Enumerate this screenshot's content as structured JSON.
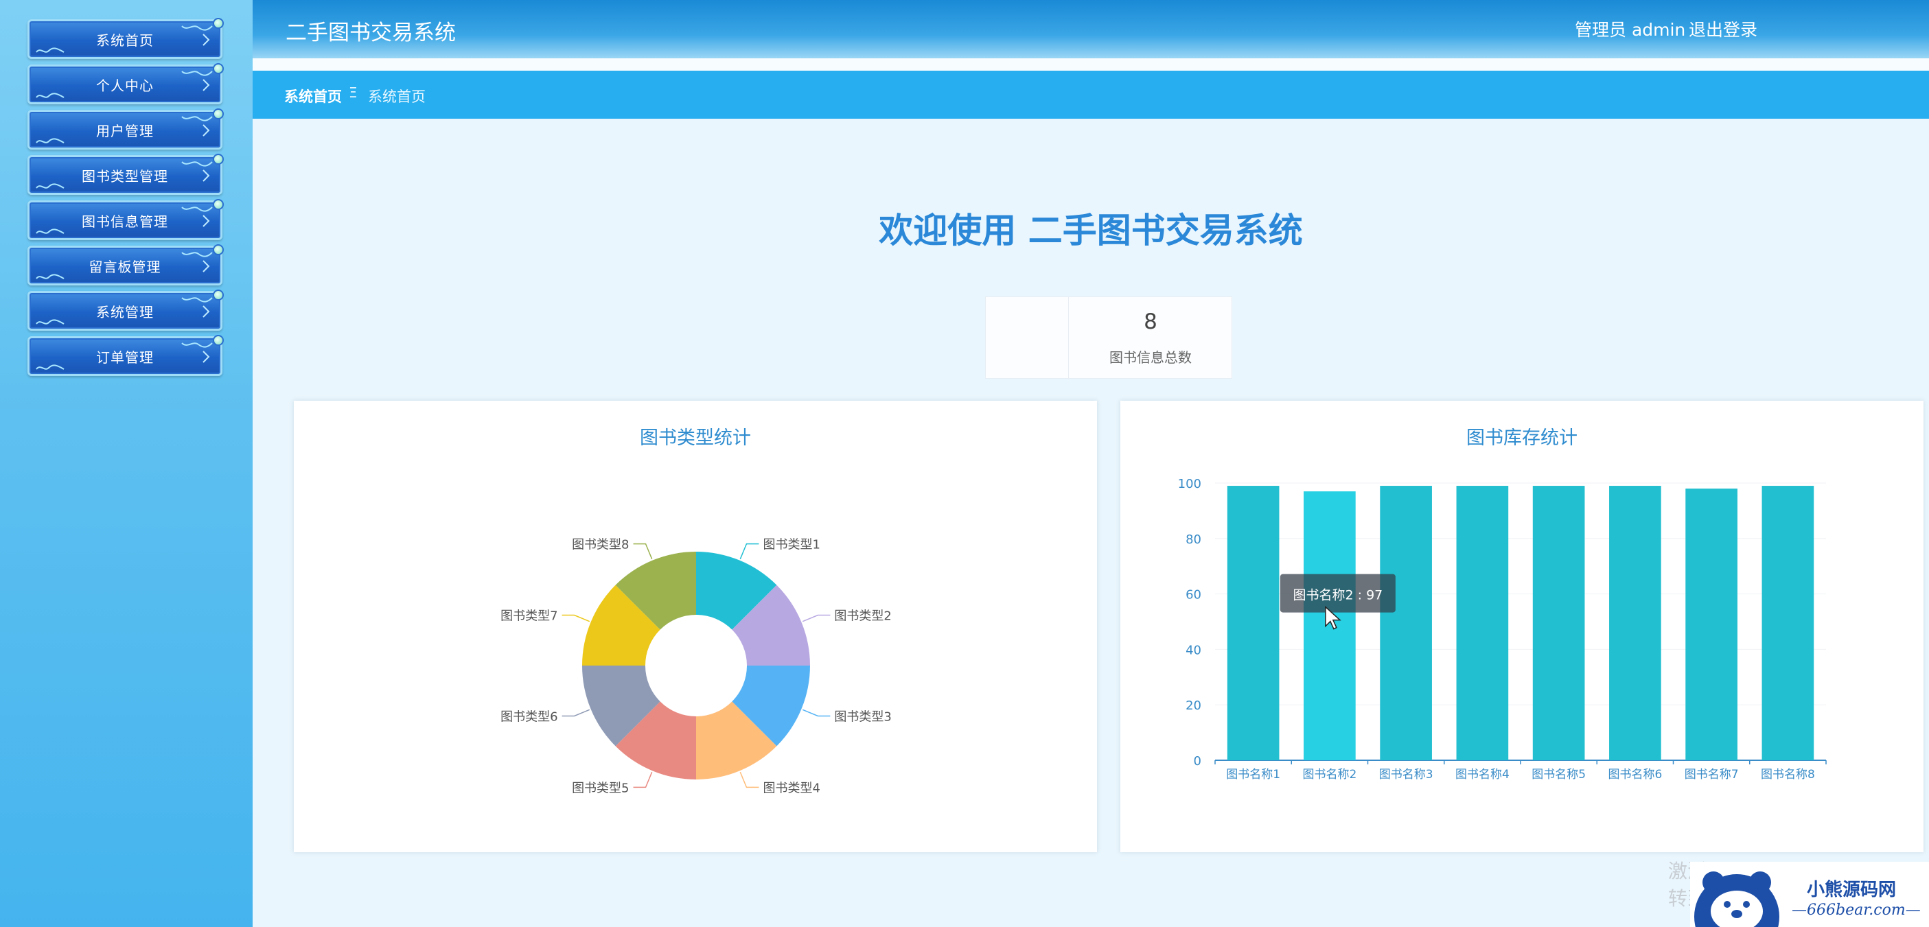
{
  "header": {
    "app_title": "二手图书交易系统",
    "admin_role": "管理员 admin",
    "logout_label": "退出登录"
  },
  "breadcrumb": {
    "home": "系统首页",
    "separator": "Ξ",
    "current": "系统首页"
  },
  "sidebar": {
    "items": [
      {
        "label": "系统首页"
      },
      {
        "label": "个人中心"
      },
      {
        "label": "用户管理"
      },
      {
        "label": "图书类型管理"
      },
      {
        "label": "图书信息管理"
      },
      {
        "label": "留言板管理"
      },
      {
        "label": "系统管理"
      },
      {
        "label": "订单管理"
      }
    ]
  },
  "main": {
    "welcome": "欢迎使用 二手图书交易系统",
    "stat": {
      "value": "8",
      "label": "图书信息总数"
    }
  },
  "chart_data": [
    {
      "type": "pie",
      "title": "图书类型统计",
      "donut": true,
      "categories": [
        "图书类型1",
        "图书类型2",
        "图书类型3",
        "图书类型4",
        "图书类型5",
        "图书类型6",
        "图书类型7",
        "图书类型8"
      ],
      "values": [
        1,
        1,
        1,
        1,
        1,
        1,
        1,
        1
      ],
      "colors": [
        "#22bfd4",
        "#b8a8e2",
        "#55b3f5",
        "#ffbd7a",
        "#e88a82",
        "#8f9bb5",
        "#ecc81a",
        "#9bb24f"
      ]
    },
    {
      "type": "bar",
      "title": "图书库存统计",
      "categories": [
        "图书名称1",
        "图书名称2",
        "图书名称3",
        "图书名称4",
        "图书名称5",
        "图书名称6",
        "图书名称7",
        "图书名称8"
      ],
      "values": [
        99,
        97,
        99,
        99,
        99,
        99,
        98,
        99
      ],
      "ylim": [
        0,
        100
      ],
      "yticks": [
        0,
        20,
        40,
        60,
        80,
        100
      ],
      "color": "#22bfd0",
      "highlight_color": "#27d0e2",
      "tooltip": "图书名称2 : 97",
      "grid": true
    }
  ],
  "watermark": {
    "line1": "激活 Windows",
    "line2": "转到",
    "brand": "小熊源码网",
    "site": "—666bear.com—"
  }
}
